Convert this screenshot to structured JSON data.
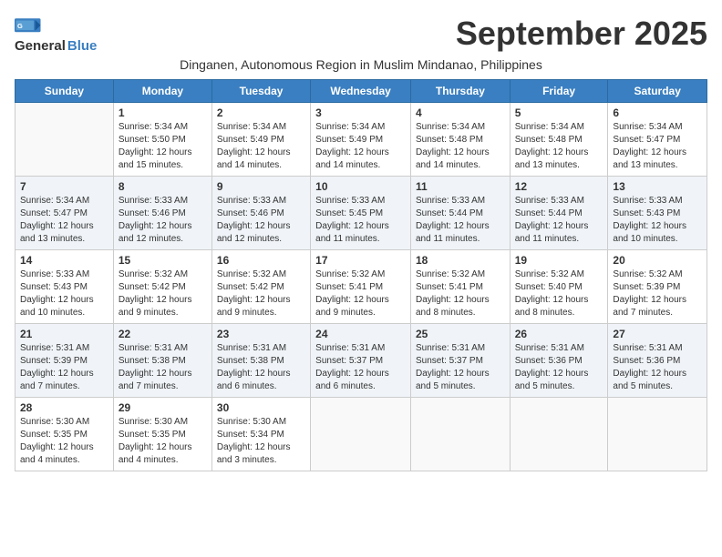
{
  "header": {
    "logo_general": "General",
    "logo_blue": "Blue",
    "month_title": "September 2025",
    "subtitle": "Dinganen, Autonomous Region in Muslim Mindanao, Philippines"
  },
  "days_of_week": [
    "Sunday",
    "Monday",
    "Tuesday",
    "Wednesday",
    "Thursday",
    "Friday",
    "Saturday"
  ],
  "weeks": [
    {
      "shaded": false,
      "days": [
        {
          "num": "",
          "empty": true
        },
        {
          "num": "1",
          "sunrise": "5:34 AM",
          "sunset": "5:50 PM",
          "daylight": "12 hours and 15 minutes."
        },
        {
          "num": "2",
          "sunrise": "5:34 AM",
          "sunset": "5:49 PM",
          "daylight": "12 hours and 14 minutes."
        },
        {
          "num": "3",
          "sunrise": "5:34 AM",
          "sunset": "5:49 PM",
          "daylight": "12 hours and 14 minutes."
        },
        {
          "num": "4",
          "sunrise": "5:34 AM",
          "sunset": "5:48 PM",
          "daylight": "12 hours and 14 minutes."
        },
        {
          "num": "5",
          "sunrise": "5:34 AM",
          "sunset": "5:48 PM",
          "daylight": "12 hours and 13 minutes."
        },
        {
          "num": "6",
          "sunrise": "5:34 AM",
          "sunset": "5:47 PM",
          "daylight": "12 hours and 13 minutes."
        }
      ]
    },
    {
      "shaded": true,
      "days": [
        {
          "num": "7",
          "sunrise": "5:34 AM",
          "sunset": "5:47 PM",
          "daylight": "12 hours and 13 minutes."
        },
        {
          "num": "8",
          "sunrise": "5:33 AM",
          "sunset": "5:46 PM",
          "daylight": "12 hours and 12 minutes."
        },
        {
          "num": "9",
          "sunrise": "5:33 AM",
          "sunset": "5:46 PM",
          "daylight": "12 hours and 12 minutes."
        },
        {
          "num": "10",
          "sunrise": "5:33 AM",
          "sunset": "5:45 PM",
          "daylight": "12 hours and 11 minutes."
        },
        {
          "num": "11",
          "sunrise": "5:33 AM",
          "sunset": "5:44 PM",
          "daylight": "12 hours and 11 minutes."
        },
        {
          "num": "12",
          "sunrise": "5:33 AM",
          "sunset": "5:44 PM",
          "daylight": "12 hours and 11 minutes."
        },
        {
          "num": "13",
          "sunrise": "5:33 AM",
          "sunset": "5:43 PM",
          "daylight": "12 hours and 10 minutes."
        }
      ]
    },
    {
      "shaded": false,
      "days": [
        {
          "num": "14",
          "sunrise": "5:33 AM",
          "sunset": "5:43 PM",
          "daylight": "12 hours and 10 minutes."
        },
        {
          "num": "15",
          "sunrise": "5:32 AM",
          "sunset": "5:42 PM",
          "daylight": "12 hours and 9 minutes."
        },
        {
          "num": "16",
          "sunrise": "5:32 AM",
          "sunset": "5:42 PM",
          "daylight": "12 hours and 9 minutes."
        },
        {
          "num": "17",
          "sunrise": "5:32 AM",
          "sunset": "5:41 PM",
          "daylight": "12 hours and 9 minutes."
        },
        {
          "num": "18",
          "sunrise": "5:32 AM",
          "sunset": "5:41 PM",
          "daylight": "12 hours and 8 minutes."
        },
        {
          "num": "19",
          "sunrise": "5:32 AM",
          "sunset": "5:40 PM",
          "daylight": "12 hours and 8 minutes."
        },
        {
          "num": "20",
          "sunrise": "5:32 AM",
          "sunset": "5:39 PM",
          "daylight": "12 hours and 7 minutes."
        }
      ]
    },
    {
      "shaded": true,
      "days": [
        {
          "num": "21",
          "sunrise": "5:31 AM",
          "sunset": "5:39 PM",
          "daylight": "12 hours and 7 minutes."
        },
        {
          "num": "22",
          "sunrise": "5:31 AM",
          "sunset": "5:38 PM",
          "daylight": "12 hours and 7 minutes."
        },
        {
          "num": "23",
          "sunrise": "5:31 AM",
          "sunset": "5:38 PM",
          "daylight": "12 hours and 6 minutes."
        },
        {
          "num": "24",
          "sunrise": "5:31 AM",
          "sunset": "5:37 PM",
          "daylight": "12 hours and 6 minutes."
        },
        {
          "num": "25",
          "sunrise": "5:31 AM",
          "sunset": "5:37 PM",
          "daylight": "12 hours and 5 minutes."
        },
        {
          "num": "26",
          "sunrise": "5:31 AM",
          "sunset": "5:36 PM",
          "daylight": "12 hours and 5 minutes."
        },
        {
          "num": "27",
          "sunrise": "5:31 AM",
          "sunset": "5:36 PM",
          "daylight": "12 hours and 5 minutes."
        }
      ]
    },
    {
      "shaded": false,
      "days": [
        {
          "num": "28",
          "sunrise": "5:30 AM",
          "sunset": "5:35 PM",
          "daylight": "12 hours and 4 minutes."
        },
        {
          "num": "29",
          "sunrise": "5:30 AM",
          "sunset": "5:35 PM",
          "daylight": "12 hours and 4 minutes."
        },
        {
          "num": "30",
          "sunrise": "5:30 AM",
          "sunset": "5:34 PM",
          "daylight": "12 hours and 3 minutes."
        },
        {
          "num": "",
          "empty": true
        },
        {
          "num": "",
          "empty": true
        },
        {
          "num": "",
          "empty": true
        },
        {
          "num": "",
          "empty": true
        }
      ]
    }
  ]
}
